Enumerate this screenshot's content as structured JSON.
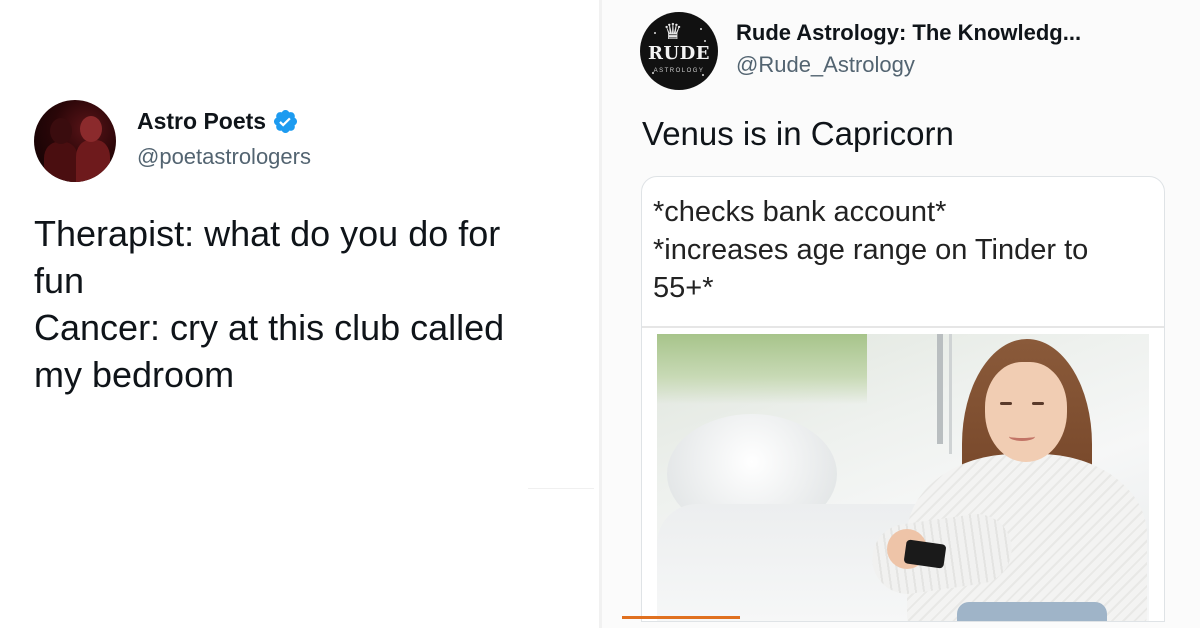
{
  "left_tweet": {
    "display_name": "Astro Poets",
    "handle": "@poetastrologers",
    "verified": true,
    "lines": [
      "Therapist: what do you do for",
      "fun",
      "Cancer: cry at this club called",
      "my bedroom"
    ]
  },
  "right_tweet": {
    "display_name": "Rude Astrology: The Knowledg...",
    "handle": "@Rude_Astrology",
    "avatar": {
      "logo_text": "RUDE",
      "logo_subtext": "ASTROLOGY",
      "icon": "crown-icon"
    },
    "text": "Venus is in Capricorn",
    "card": {
      "lines": [
        "*checks bank account*",
        "*increases age range on Tinder to",
        "55+*"
      ],
      "image": "woman-smiling-at-phone-photo"
    }
  },
  "colors": {
    "verified_blue": "#1d9bf0",
    "handle_gray": "#536471",
    "accent_orange": "#e0701f"
  }
}
